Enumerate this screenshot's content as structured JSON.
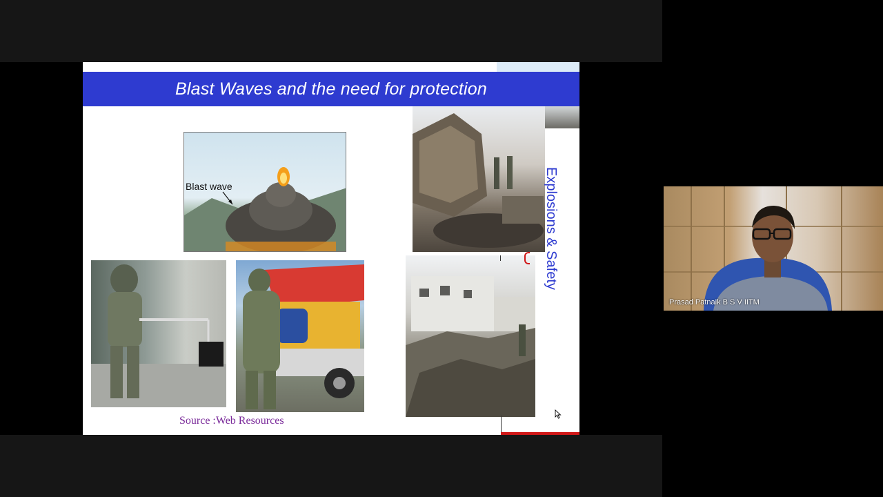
{
  "slide": {
    "title": "Blast Waves and the need for protection",
    "vertical_label": "Explosions & Safety",
    "blast_label": "Blast wave",
    "source": "Source :Web Resources"
  },
  "participant": {
    "name": "Prasad Patnaik B S V IITM"
  },
  "colors": {
    "title_bar": "#2e3bd0",
    "source_text": "#7a2a9a",
    "accent_red": "#d01818"
  }
}
